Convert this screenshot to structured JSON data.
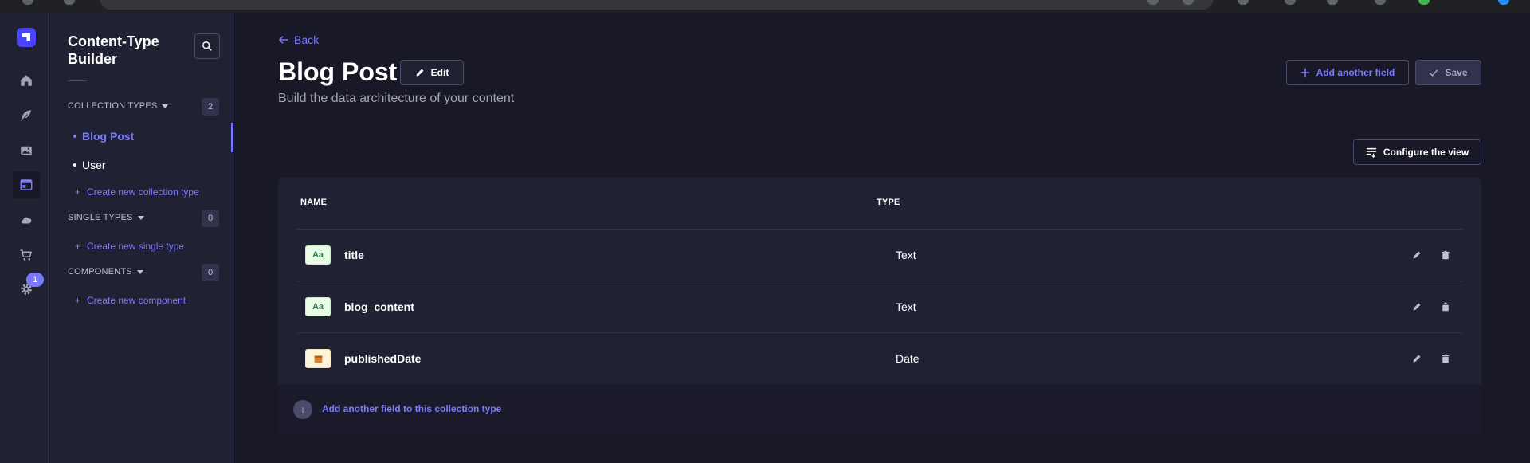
{
  "sidebar_nav": {
    "items": [
      "home-icon",
      "feather-icon",
      "image-icon",
      "layout-icon",
      "cloud-icon",
      "cart-icon",
      "gear-icon"
    ],
    "settings_badge": "1",
    "accent": "#4945ff"
  },
  "subnav": {
    "title": "Content-Type Builder",
    "collection_types": {
      "label": "COLLECTION TYPES",
      "count": "2",
      "items": [
        {
          "label": "Blog Post",
          "active": true
        },
        {
          "label": "User",
          "active": false
        }
      ],
      "create_label": "Create new collection type"
    },
    "single_types": {
      "label": "SINGLE TYPES",
      "count": "0",
      "create_label": "Create new single type"
    },
    "components": {
      "label": "COMPONENTS",
      "count": "0",
      "create_label": "Create new component"
    }
  },
  "header": {
    "back_label": "Back",
    "title": "Blog Post",
    "edit_label": "Edit",
    "subtitle": "Build the data architecture of your content",
    "add_field_label": "Add another field",
    "save_label": "Save",
    "configure_label": "Configure the view"
  },
  "table": {
    "columns": [
      "NAME",
      "TYPE"
    ],
    "rows": [
      {
        "name": "title",
        "type": "Text",
        "icon_text": "Aa",
        "icon": "text-field-icon"
      },
      {
        "name": "blog_content",
        "type": "Text",
        "icon_text": "Aa",
        "icon": "text-field-icon"
      },
      {
        "name": "publishedDate",
        "type": "Date",
        "icon_text": "",
        "icon": "calendar-icon"
      }
    ],
    "footer_label": "Add another field to this collection type"
  }
}
